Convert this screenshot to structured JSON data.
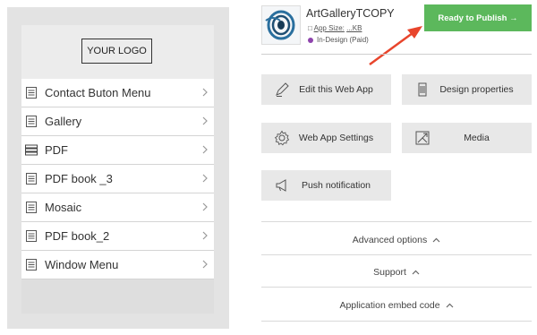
{
  "preview": {
    "logo_text": "YOUR LOGO",
    "menu_items": [
      {
        "label": "Contact Buton Menu",
        "icon": "page-icon"
      },
      {
        "label": "Gallery",
        "icon": "page-icon"
      },
      {
        "label": "PDF",
        "icon": "stack-icon"
      },
      {
        "label": "PDF book _3",
        "icon": "page-icon"
      },
      {
        "label": "Mosaic",
        "icon": "page-icon"
      },
      {
        "label": "PDF book_2",
        "icon": "page-icon"
      },
      {
        "label": "Window Menu",
        "icon": "page-icon"
      }
    ]
  },
  "app": {
    "name": "ArtGalleryTCOPY",
    "size_label": "App Size:",
    "size_value": "...KB",
    "status": "In-Design (Paid)",
    "status_color": "#8e44ad",
    "publish_label": "Ready to Publish →",
    "publish_color": "#5cb85c"
  },
  "actions": {
    "edit": "Edit this Web App",
    "design": "Design properties",
    "settings": "Web App Settings",
    "media": "Media",
    "push": "Push notification"
  },
  "sections": {
    "advanced": "Advanced options",
    "support": "Support",
    "embed": "Application embed code"
  },
  "annotation_color": "#e8452c"
}
